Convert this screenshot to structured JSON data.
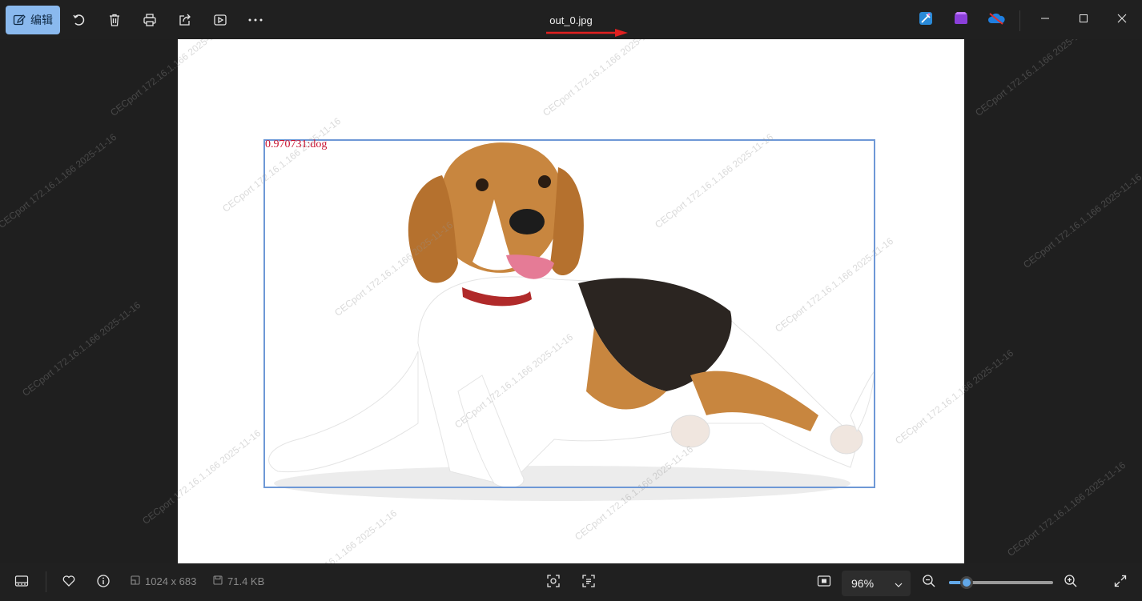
{
  "toolbar": {
    "edit_label": "编辑",
    "icons": [
      "edit-icon",
      "rotate-icon",
      "delete-icon",
      "print-icon",
      "share-icon",
      "slideshow-icon",
      "more-icon"
    ]
  },
  "window": {
    "title": "out_0.jpg",
    "app_icons": [
      "designer-icon",
      "clipchamp-icon",
      "onedrive-icon"
    ],
    "controls": [
      "minimize-icon",
      "maximize-icon",
      "close-icon"
    ]
  },
  "image": {
    "detection_label": "0.970731:dog",
    "box_color": "#6e98d6",
    "label_color": "#c8102e",
    "watermark": "CECport 172.16.1.166 2025-11-16"
  },
  "status": {
    "dimensions": "1024 x 683",
    "file_size": "71.4 KB"
  },
  "zoom": {
    "value_label": "96%",
    "slider_fraction": 0.17
  },
  "colors": {
    "accent": "#8ab9ee",
    "slider": "#62a8e8",
    "background": "#1f1f1f"
  }
}
